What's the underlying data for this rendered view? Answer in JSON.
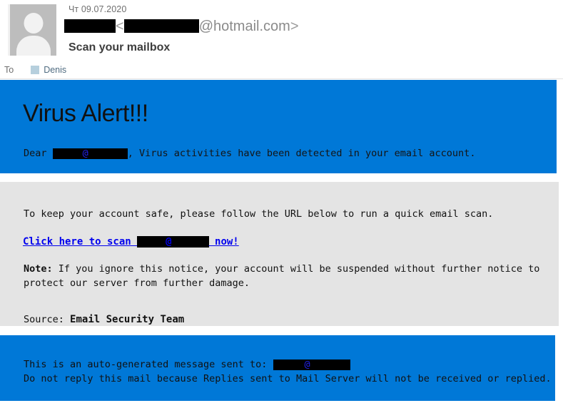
{
  "colors": {
    "alert_blue": "#0078d7",
    "notice_gray": "#e4e4e4",
    "link_blue": "#0000ee",
    "avatar_gray": "#bdbdbd",
    "recipient_chip": "#b6cfdd"
  },
  "header": {
    "avatar_icon": "person-placeholder-icon",
    "date": "Чт 09.07.2020",
    "from_domain": "@hotmail.com",
    "from_open_angle": "<",
    "from_close_angle": ">",
    "subject": "Scan your mailbox",
    "to_label": "To",
    "to_recipient": "Denis"
  },
  "alert": {
    "title": "Virus Alert!!!",
    "greeting_prefix": "Dear ",
    "at_symbol": "@",
    "greeting_suffix": ", Virus activities have been detected in your email account."
  },
  "notice": {
    "intro": "To keep your account safe, please follow the URL below to run a quick email scan.",
    "link_prefix": "Click here to scan ",
    "link_at": "@",
    "link_suffix": " now!",
    "note_label": "Note:",
    "note_text": " If you ignore this notice, your account will be suspended without further notice to protect our server from further damage.",
    "source_label": "Source: ",
    "source_value": "Email Security Team"
  },
  "footer": {
    "line1_prefix": "This is an auto-generated message sent to: ",
    "line1_at": "@",
    "line2": "Do not reply this mail because Replies sent to Mail Server will not be received or replied."
  }
}
